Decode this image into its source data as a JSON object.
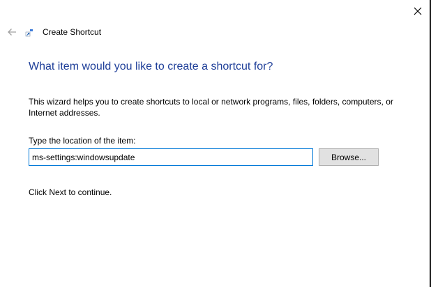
{
  "titlebar": {
    "close_icon": "close-icon"
  },
  "header": {
    "back_icon": "back-arrow-icon",
    "wizard_icon": "shortcut-icon",
    "title": "Create Shortcut"
  },
  "main": {
    "heading": "What item would you like to create a shortcut for?",
    "description": "This wizard helps you to create shortcuts to local or network programs, files, folders, computers, or Internet addresses.",
    "location_label": "Type the location of the item:",
    "location_value": "ms-settings:windowsupdate",
    "browse_label": "Browse...",
    "continue_text": "Click Next to continue."
  },
  "colors": {
    "heading": "#1f3f99",
    "input_border_focus": "#0078d7",
    "button_face": "#e1e1e1",
    "button_border": "#adadad",
    "back_arrow_disabled": "#a0a0a0"
  }
}
